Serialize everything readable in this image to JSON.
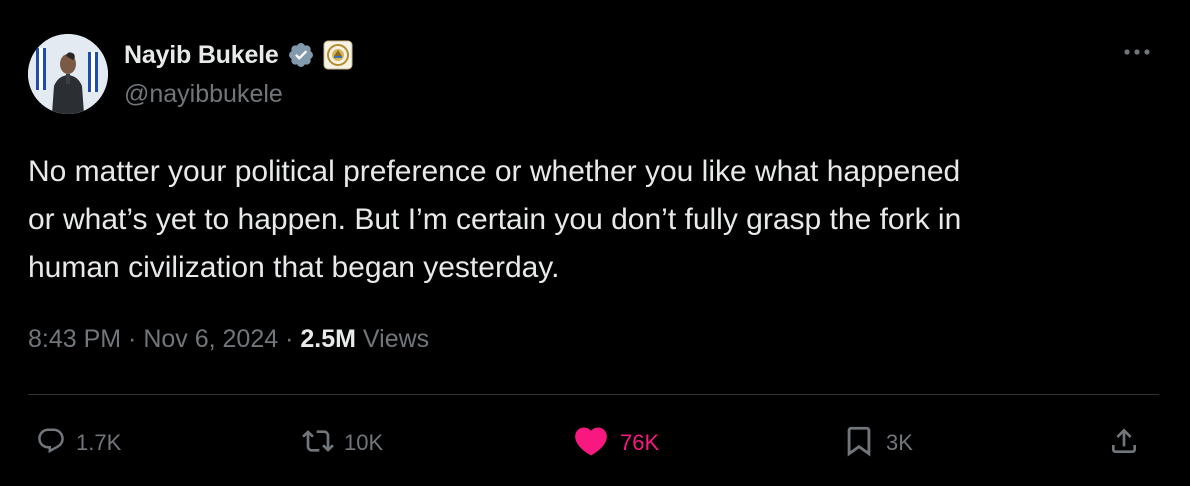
{
  "author": {
    "display_name": "Nayib Bukele",
    "handle": "@nayibbukele",
    "verified_icon": "verified-badge-icon",
    "affiliate_badge_icon": "el-salvador-government-seal-icon",
    "avatar": "profile-photo"
  },
  "tweet": {
    "text": "No matter your political preference or whether you like what happened\nor what’s yet to happen. But I’m certain you don’t fully grasp the fork in\nhuman civilization that began yesterday."
  },
  "meta": {
    "time": "8:43 PM",
    "separator": " · ",
    "date": "Nov 6, 2024",
    "views_count": "2.5M",
    "views_label": " Views"
  },
  "actions": {
    "reply": {
      "icon": "reply-icon",
      "count": "1.7K"
    },
    "retweet": {
      "icon": "retweet-icon",
      "count": "10K"
    },
    "like": {
      "icon": "heart-filled-icon",
      "count": "76K",
      "liked": true
    },
    "bookmark": {
      "icon": "bookmark-icon",
      "count": "3K"
    },
    "share": {
      "icon": "share-icon"
    }
  },
  "colors": {
    "background": "#000000",
    "primary_text": "#e7e9ea",
    "secondary_text": "#71767b",
    "like_pink": "#f91880",
    "divider": "#2f3336"
  }
}
